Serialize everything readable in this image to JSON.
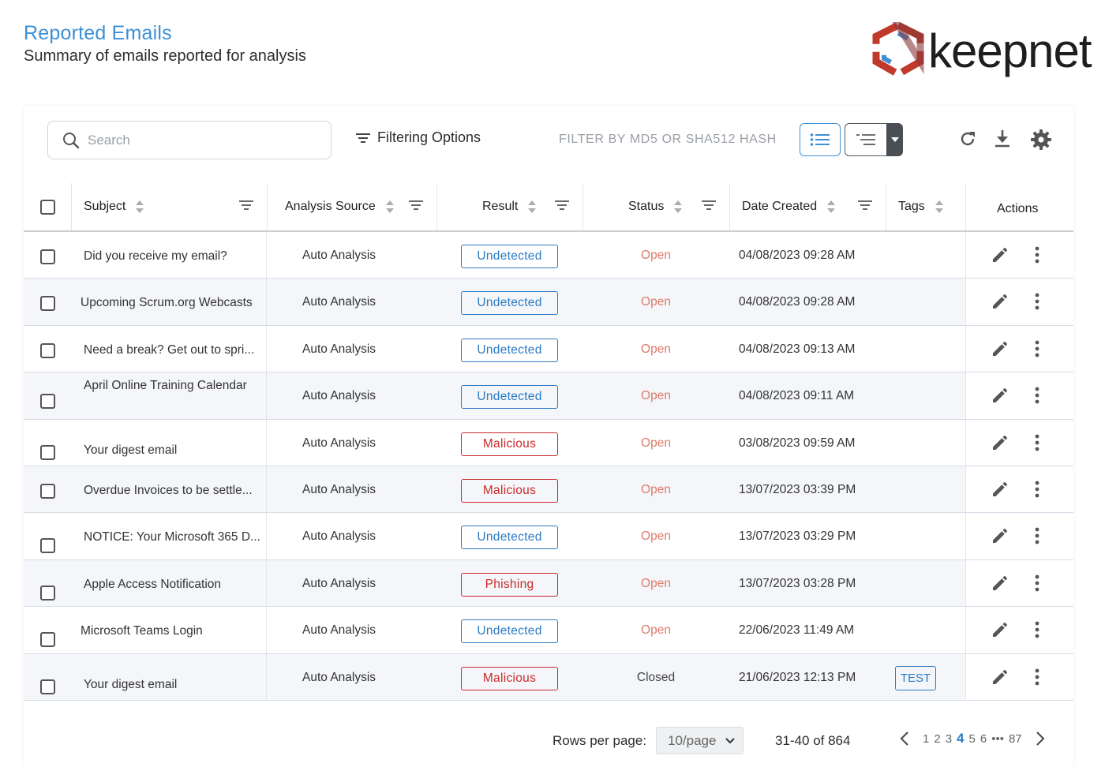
{
  "header": {
    "title": "Reported Emails",
    "subtitle": "Summary of emails reported for analysis",
    "logo_text": "keepnet"
  },
  "toolbar": {
    "search_placeholder": "Search",
    "filtering_options_label": "Filtering Options",
    "hash_filter_label": "FILTER BY MD5 OR SHA512 HASH"
  },
  "columns": {
    "subject": "Subject",
    "analysis_source": "Analysis Source",
    "result": "Result",
    "status": "Status",
    "date_created": "Date Created",
    "tags": "Tags",
    "actions": "Actions"
  },
  "rows": [
    {
      "subject": "Did you receive my email?",
      "source": "Auto Analysis",
      "result": "Undetected",
      "result_type": "blue",
      "status": "Open",
      "status_type": "open",
      "date": "04/08/2023 09:28 AM",
      "tag": ""
    },
    {
      "subject": "Upcoming Scrum.org Webcasts",
      "source": "Auto Analysis",
      "result": "Undetected",
      "result_type": "blue",
      "status": "Open",
      "status_type": "open",
      "date": "04/08/2023 09:28 AM",
      "tag": ""
    },
    {
      "subject": "Need a break? Get out to spri...",
      "source": "Auto Analysis",
      "result": "Undetected",
      "result_type": "blue",
      "status": "Open",
      "status_type": "open",
      "date": "04/08/2023 09:13 AM",
      "tag": ""
    },
    {
      "subject": "April Online Training Calendar",
      "source": "Auto Analysis",
      "result": "Undetected",
      "result_type": "blue",
      "status": "Open",
      "status_type": "open",
      "date": "04/08/2023 09:11 AM",
      "tag": ""
    },
    {
      "subject": "Your digest email",
      "source": "Auto Analysis",
      "result": "Malicious",
      "result_type": "red",
      "status": "Open",
      "status_type": "open",
      "date": "03/08/2023 09:59 AM",
      "tag": ""
    },
    {
      "subject": "Overdue Invoices to be settle...",
      "source": "Auto Analysis",
      "result": "Malicious",
      "result_type": "red",
      "status": "Open",
      "status_type": "open",
      "date": "13/07/2023 03:39 PM",
      "tag": ""
    },
    {
      "subject": "NOTICE: Your Microsoft 365 D...",
      "source": "Auto Analysis",
      "result": "Undetected",
      "result_type": "blue",
      "status": "Open",
      "status_type": "open",
      "date": "13/07/2023 03:29 PM",
      "tag": ""
    },
    {
      "subject": "Apple Access Notification",
      "source": "Auto Analysis",
      "result": "Phishing",
      "result_type": "red",
      "status": "Open",
      "status_type": "open",
      "date": "13/07/2023 03:28 PM",
      "tag": ""
    },
    {
      "subject": "Microsoft Teams Login",
      "source": "Auto Analysis",
      "result": "Undetected",
      "result_type": "blue",
      "status": "Open",
      "status_type": "open",
      "date": "22/06/2023 11:49 AM",
      "tag": ""
    },
    {
      "subject": "Your digest email",
      "source": "Auto Analysis",
      "result": "Malicious",
      "result_type": "red",
      "status": "Closed",
      "status_type": "closed",
      "date": "21/06/2023 12:13 PM",
      "tag": "TEST"
    }
  ],
  "footer": {
    "rows_per_page_label": "Rows per page:",
    "rows_per_page_value": "10/page",
    "range_label": "31-40 of 864",
    "pages": [
      "1",
      "2",
      "3",
      "4",
      "5",
      "6",
      "•••",
      "87"
    ],
    "current_page": "4"
  },
  "colors": {
    "accent": "#3d8fd6",
    "malicious": "#c92a2a",
    "undetected": "#2a7ac4",
    "open_status": "#de7b6a"
  }
}
